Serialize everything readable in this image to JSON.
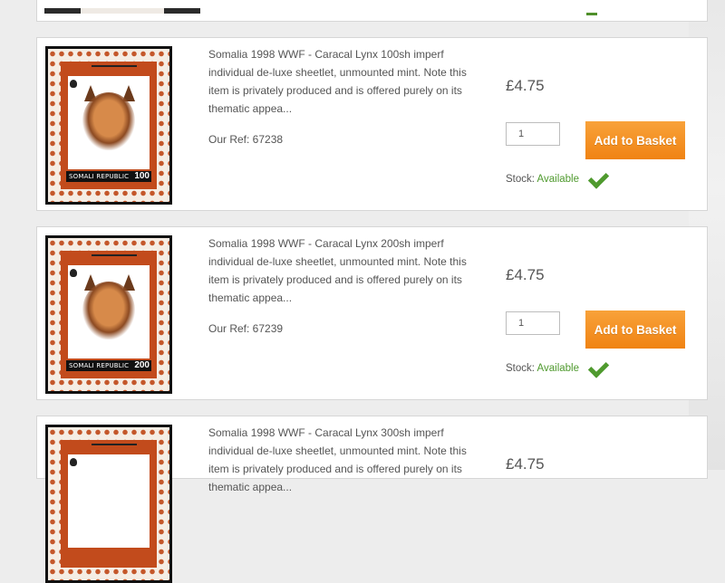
{
  "products": [
    {
      "description": "Somalia 1998 WWF - Caracal Lynx 100sh imperf individual de-luxe sheetlet, unmounted mint. Note this item is privately produced and is offered purely on its thematic appea...",
      "ref": "Our Ref: 67238",
      "price": "£4.75",
      "quantity": "1",
      "add_label": "Add to Basket",
      "stock_label": "Stock:",
      "stock_status": "Available",
      "stamp": {
        "country": "SOMALI REPUBLIC",
        "value": "100"
      }
    },
    {
      "description": "Somalia 1998 WWF - Caracal Lynx 200sh imperf individual de-luxe sheetlet, unmounted mint. Note this item is privately produced and is offered purely on its thematic appea...",
      "ref": "Our Ref: 67239",
      "price": "£4.75",
      "quantity": "1",
      "add_label": "Add to Basket",
      "stock_label": "Stock:",
      "stock_status": "Available",
      "stamp": {
        "country": "SOMALI REPUBLIC",
        "value": "200"
      }
    },
    {
      "description": "Somalia 1998 WWF - Caracal Lynx 300sh imperf individual de-luxe sheetlet, unmounted mint. Note this item is privately produced and is offered purely on its thematic appea...",
      "price": "£4.75"
    }
  ],
  "colors": {
    "button_orange": "#f08313",
    "stock_green": "#4f9a2e",
    "stamp_border_red": "#c24b1c"
  },
  "icons": {
    "available": "checkmark-icon"
  }
}
